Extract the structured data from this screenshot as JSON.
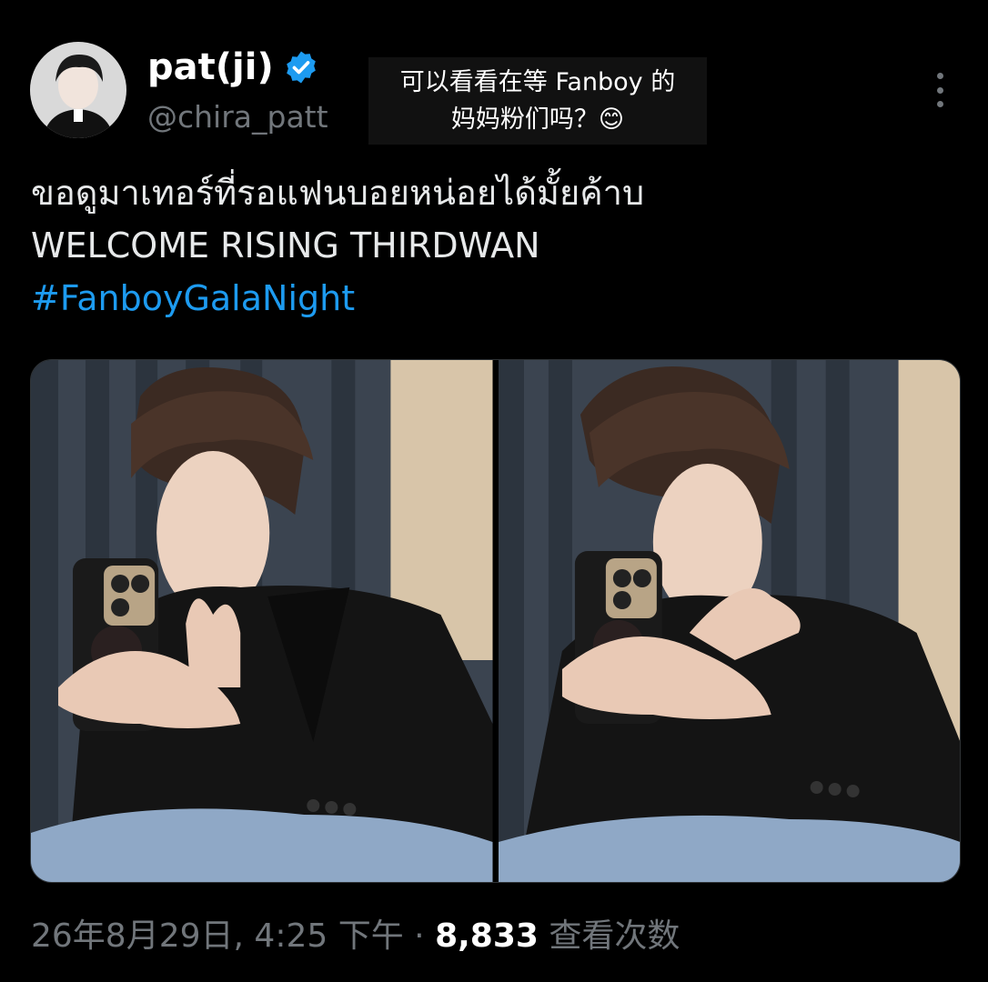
{
  "author": {
    "display_name": "pat(ji)",
    "handle": "@chira_patt",
    "verified_color": "#1d9bf0"
  },
  "overlay_caption": {
    "line1": "可以看看在等 Fanboy 的",
    "line2": "妈妈粉们吗？😊"
  },
  "tweet": {
    "line1": "ขอดูมาเทอร์ที่รอแฟนบอยหน่อยได้มั้ยค้าบ",
    "line2": "WELCOME RISING THIRDWAN",
    "hashtag": "#FanboyGalaNight"
  },
  "media": {
    "photo_count": 2,
    "icons": [
      "photo-left",
      "photo-right"
    ]
  },
  "meta": {
    "timestamp": "26年8月29日, 4:25 下午",
    "separator": "·",
    "view_count": "8,833",
    "views_label": "查看次数"
  },
  "colors": {
    "background": "#000000",
    "text": "#e7e9ea",
    "secondary": "#71767b",
    "accent": "#1d9bf0"
  }
}
